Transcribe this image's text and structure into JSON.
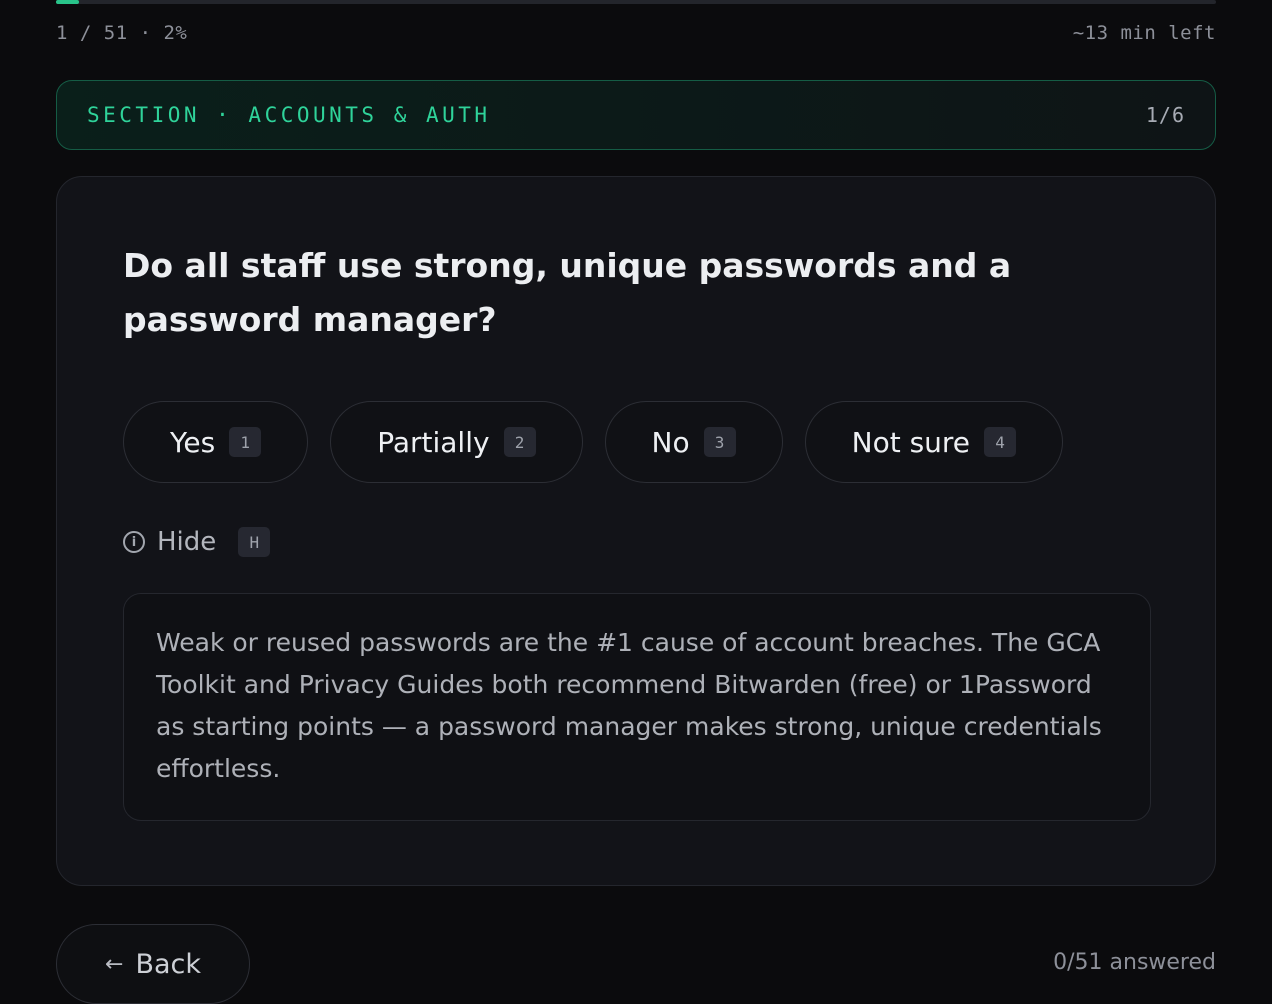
{
  "progress": {
    "current_label": "1 / 51 · 2%",
    "percent": 2,
    "time_left": "~13 min left"
  },
  "section": {
    "title": "SECTION · ACCOUNTS & AUTH",
    "count": "1/6"
  },
  "question": {
    "text": "Do all staff use strong, unique passwords and a password manager?"
  },
  "options": [
    {
      "label": "Yes",
      "key": "1"
    },
    {
      "label": "Partially",
      "key": "2"
    },
    {
      "label": "No",
      "key": "3"
    },
    {
      "label": "Not sure",
      "key": "4"
    }
  ],
  "hint": {
    "toggle_label": "Hide",
    "toggle_key": "H",
    "icon": "info-icon",
    "text": "Weak or reused passwords are the #1 cause of account breaches. The GCA Toolkit and Privacy Guides both recommend Bitwarden (free) or 1Password as starting points — a password manager makes strong, unique credentials effortless."
  },
  "footer": {
    "back_arrow": "←",
    "back_label": "Back",
    "answered": "0/51 answered"
  },
  "colors": {
    "accent": "#29c48a",
    "section_text": "#2fd39a",
    "background": "#0b0b0d",
    "card": "#121318"
  }
}
